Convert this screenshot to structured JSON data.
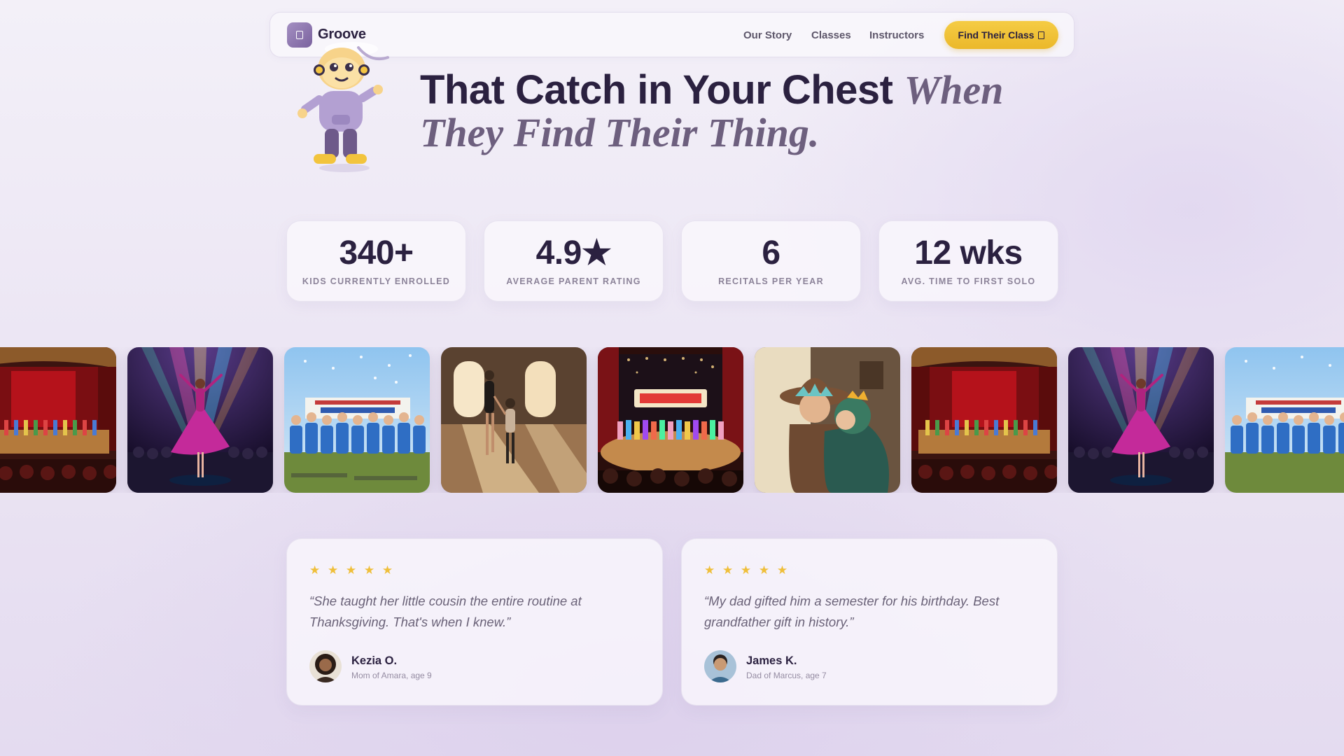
{
  "brand": {
    "name": "Groove",
    "logo_icon": "sparkle-icon"
  },
  "nav": {
    "links": [
      "Our Story",
      "Classes",
      "Instructors"
    ],
    "cta_label": "Find Their Class",
    "cta_icon": "arrow-right-icon"
  },
  "hero": {
    "headline_strong": "That Catch in Your Chest",
    "headline_italic": "When They Find Their Thing."
  },
  "stats": [
    {
      "value": "340+",
      "label": "KIDS CURRENTLY ENROLLED"
    },
    {
      "value": "4.9★",
      "label": "AVERAGE PARENT RATING"
    },
    {
      "value": "6",
      "label": "RECITALS PER YEAR"
    },
    {
      "value": "12 wks",
      "label": "AVG. TIME TO FIRST SOLO"
    }
  ],
  "gallery": [
    "recital-stage-group-photo",
    "spotlight-dancer-photo",
    "team-banner-celebration-photo",
    "dance-lesson-studio-photo",
    "grand-finale-stage-photo",
    "parent-child-hug-photo",
    "recital-stage-group-photo",
    "spotlight-dancer-photo",
    "team-banner-celebration-photo"
  ],
  "testimonials": [
    {
      "stars": "★ ★ ★ ★ ★",
      "quote": "“She taught her little cousin the entire routine at Thanksgiving. That's when I knew.”",
      "name": "Kezia O.",
      "role": "Mom of Amara, age 9"
    },
    {
      "stars": "★ ★ ★ ★ ★",
      "quote": "“My dad gifted him a semester for his birthday. Best grandfather gift in history.”",
      "name": "James K.",
      "role": "Dad of Marcus, age 7"
    }
  ],
  "colors": {
    "accent_yellow": "#f2c43d",
    "ink": "#2b2140",
    "muted_purple": "#6d5f7e",
    "brand_purple": "#8f78b0"
  }
}
